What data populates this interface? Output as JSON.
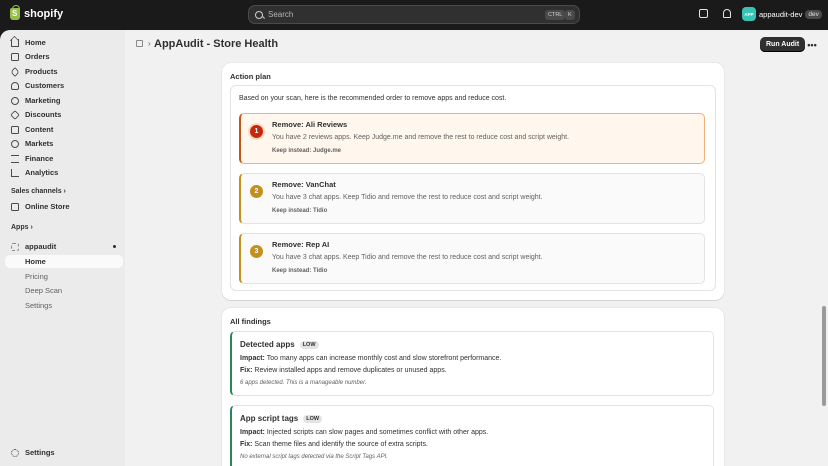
{
  "topbar": {
    "brand": "shopify",
    "search_placeholder": "Search",
    "kbd_ctrl": "CTRL",
    "kbd_k": "K",
    "store_initials": "APP",
    "store_name": "appaudit-dev",
    "store_badge": "dev"
  },
  "sidebar": {
    "items": [
      {
        "label": "Home",
        "icon": "home-icon"
      },
      {
        "label": "Orders",
        "icon": "orders-icon"
      },
      {
        "label": "Products",
        "icon": "tag-icon"
      },
      {
        "label": "Customers",
        "icon": "person-icon"
      },
      {
        "label": "Marketing",
        "icon": "target-icon"
      },
      {
        "label": "Discounts",
        "icon": "discount-icon"
      },
      {
        "label": "Content",
        "icon": "image-icon"
      },
      {
        "label": "Markets",
        "icon": "globe-icon"
      },
      {
        "label": "Finance",
        "icon": "bank-icon"
      },
      {
        "label": "Analytics",
        "icon": "chart-icon"
      }
    ],
    "sales_channels_label": "Sales channels ›",
    "online_store_label": "Online Store",
    "apps_label": "Apps ›",
    "app_name": "appaudit",
    "app_subitems": [
      "Home",
      "Pricing",
      "Deep Scan",
      "Settings"
    ],
    "settings_label": "Settings"
  },
  "header": {
    "breadcrumb_sep": "›",
    "title": "AppAudit - Store Health",
    "run_audit_label": "Run Audit",
    "more_label": "•••"
  },
  "action_plan": {
    "title": "Action plan",
    "intro": "Based on your scan, here is the recommended order to remove apps and reduce cost.",
    "steps": [
      {
        "num": "1",
        "title": "Remove: Ali Reviews",
        "desc": "You have 2 reviews apps. Keep Judge.me and remove the rest to reduce cost and script weight.",
        "keep": "Keep instead: Judge.me"
      },
      {
        "num": "2",
        "title": "Remove: VanChat",
        "desc": "You have 3 chat apps. Keep Tidio and remove the rest to reduce cost and script weight.",
        "keep": "Keep instead: Tidio"
      },
      {
        "num": "3",
        "title": "Remove: Rep AI",
        "desc": "You have 3 chat apps. Keep Tidio and remove the rest to reduce cost and script weight.",
        "keep": "Keep instead: Tidio"
      }
    ]
  },
  "findings": {
    "title": "All findings",
    "impact_label": "Impact:",
    "fix_label": "Fix:",
    "items": [
      {
        "title": "Detected apps",
        "badge": "LOW",
        "impact": "Too many apps can increase monthly cost and slow storefront performance.",
        "fix": "Review installed apps and remove duplicates or unused apps.",
        "note": "6 apps detected. This is a manageable number."
      },
      {
        "title": "App script tags",
        "badge": "LOW",
        "impact": "Injected scripts can slow pages and sometimes conflict with other apps.",
        "fix": "Scan theme files and identify the source of extra scripts.",
        "note": "No external script tags detected via the Script Tags API."
      }
    ]
  },
  "colors": {
    "accent_critical": "#c5280c",
    "accent_warning": "#c4901c",
    "accent_success": "#29845a"
  }
}
